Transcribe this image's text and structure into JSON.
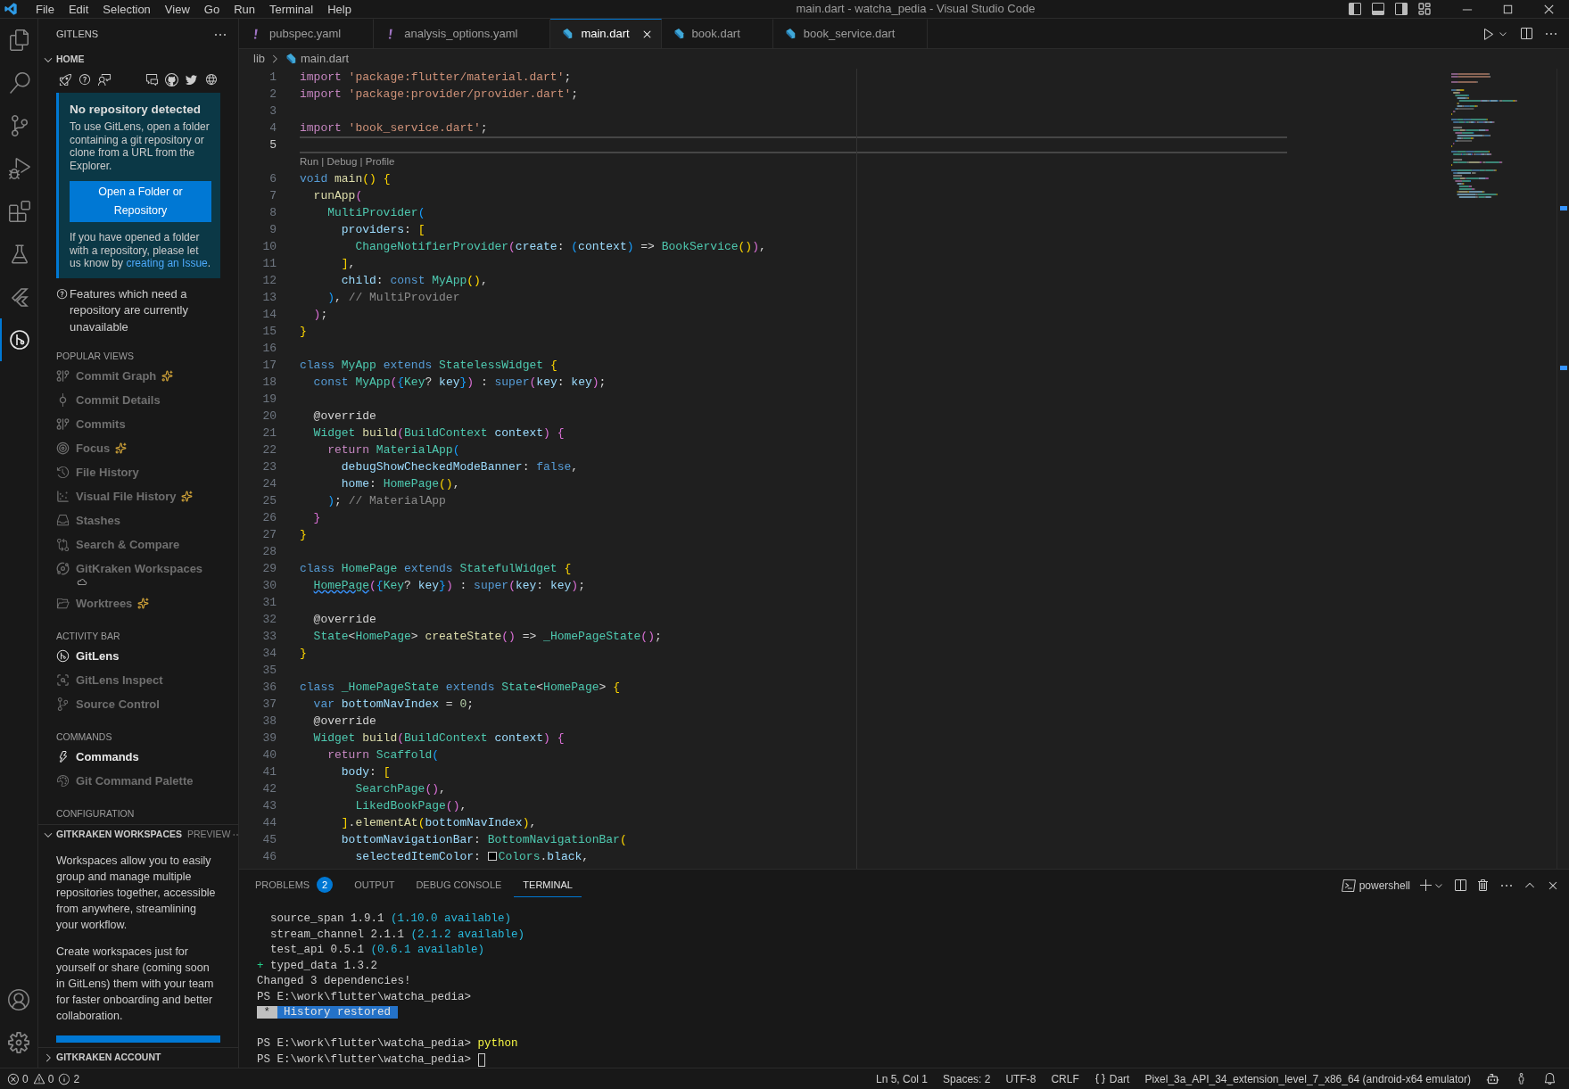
{
  "title_bar": {
    "menu": [
      "File",
      "Edit",
      "Selection",
      "View",
      "Go",
      "Run",
      "Terminal",
      "Help"
    ],
    "title": "main.dart - watcha_pedia - Visual Studio Code"
  },
  "activity_bar": {
    "items": [
      {
        "kind": "files",
        "selected": false
      },
      {
        "kind": "search",
        "selected": false
      },
      {
        "kind": "scm",
        "selected": false
      },
      {
        "kind": "debug",
        "selected": false
      },
      {
        "kind": "extensions",
        "selected": false
      },
      {
        "kind": "testing",
        "selected": false
      },
      {
        "kind": "flutter",
        "selected": false
      },
      {
        "kind": "gitlens",
        "selected": true
      }
    ],
    "bottom": [
      {
        "kind": "account"
      },
      {
        "kind": "settings"
      }
    ]
  },
  "sidebar": {
    "title": "GITLENS",
    "home": {
      "title": "HOME",
      "expanded": true,
      "card": {
        "title": "No repository detected",
        "text": "To use GitLens, open a folder containing a git repository or clone from a URL from the Explorer.",
        "button": "Open a Folder or Repository",
        "note": "If you have opened a folder with a repository, please let us know by",
        "link": "creating an Issue",
        "note_end": "."
      },
      "features_note": "Features which need a repository are currently unavailable",
      "groups": [
        {
          "title": "POPULAR VIEWS",
          "items": [
            {
              "label": "Commit Graph",
              "kind": "graph",
              "sparkle": true,
              "cloud": false,
              "disabled": true
            },
            {
              "label": "Commit Details",
              "kind": "commit",
              "sparkle": false,
              "cloud": false,
              "disabled": true
            },
            {
              "label": "Commits",
              "kind": "commits",
              "sparkle": false,
              "cloud": false,
              "disabled": true
            },
            {
              "label": "Focus",
              "kind": "focus",
              "sparkle": true,
              "cloud": false,
              "disabled": true
            },
            {
              "label": "File History",
              "kind": "history",
              "sparkle": false,
              "cloud": false,
              "disabled": true
            },
            {
              "label": "Visual File History",
              "kind": "scatter",
              "sparkle": true,
              "cloud": false,
              "disabled": true
            },
            {
              "label": "Stashes",
              "kind": "inbox",
              "sparkle": false,
              "cloud": false,
              "disabled": true
            },
            {
              "label": "Search & Compare",
              "kind": "compare",
              "sparkle": false,
              "cloud": false,
              "disabled": true
            },
            {
              "label": "GitKraken Workspaces",
              "kind": "orbit",
              "sparkle": false,
              "cloud": true,
              "disabled": true
            },
            {
              "label": "Worktrees",
              "kind": "folder",
              "sparkle": true,
              "cloud": false,
              "disabled": true
            }
          ]
        },
        {
          "title": "ACTIVITY BAR",
          "items": [
            {
              "label": "GitLens",
              "kind": "gitlens",
              "sparkle": false,
              "cloud": false,
              "disabled": false
            },
            {
              "label": "GitLens Inspect",
              "kind": "inspect",
              "sparkle": false,
              "cloud": false,
              "disabled": true
            },
            {
              "label": "Source Control",
              "kind": "scm",
              "sparkle": false,
              "cloud": false,
              "disabled": true
            }
          ]
        },
        {
          "title": "COMMANDS",
          "items": [
            {
              "label": "Commands",
              "kind": "zap",
              "sparkle": false,
              "cloud": false,
              "disabled": false
            },
            {
              "label": "Git Command Palette",
              "kind": "palette",
              "sparkle": false,
              "cloud": false,
              "disabled": true
            }
          ]
        },
        {
          "title": "CONFIGURATION"
        }
      ]
    },
    "workspaces": {
      "title": "GITKRAKEN WORKSPACES",
      "badge": "PREVIEW",
      "expanded": true,
      "paragraphs": [
        "Workspaces allow you to easily group and manage multiple repositories together, accessible from anywhere, streamlining your workflow.",
        "Create workspaces just for yourself or share (coming soon in GitLens) them with your team for faster onboarding and better collaboration."
      ]
    },
    "account": {
      "title": "GITKRAKEN ACCOUNT",
      "expanded": false
    }
  },
  "tabs": [
    {
      "label": "pubspec.yaml",
      "kind": "yaml",
      "selected": false
    },
    {
      "label": "analysis_options.yaml",
      "kind": "yaml",
      "selected": false
    },
    {
      "label": "main.dart",
      "kind": "dart",
      "selected": true
    },
    {
      "label": "book.dart",
      "kind": "dart",
      "selected": false
    },
    {
      "label": "book_service.dart",
      "kind": "dart",
      "selected": false
    }
  ],
  "breadcrumb": {
    "folder": "lib",
    "file": "main.dart"
  },
  "editor": {
    "lines": [
      {
        "kind": "code",
        "number": "1",
        "current": false,
        "tokens": [
          {
            "kind": "ctrl",
            "text": "import "
          },
          {
            "kind": "str",
            "text": "'package:flutter/material.dart'"
          },
          {
            "kind": "plain",
            "text": ";"
          }
        ]
      },
      {
        "kind": "code",
        "number": "2",
        "current": false,
        "tokens": [
          {
            "kind": "ctrl",
            "text": "import "
          },
          {
            "kind": "str",
            "text": "'package:provider/provider.dart'"
          },
          {
            "kind": "plain",
            "text": ";"
          }
        ]
      },
      {
        "kind": "code",
        "number": "3",
        "current": false
      },
      {
        "kind": "code",
        "number": "4",
        "current": false,
        "tokens": [
          {
            "kind": "ctrl",
            "text": "import "
          },
          {
            "kind": "str",
            "text": "'book_service.dart'"
          },
          {
            "kind": "plain",
            "text": ";"
          }
        ]
      },
      {
        "kind": "code",
        "number": "5",
        "current": true
      },
      {
        "kind": "codelens",
        "text": "Run | Debug | Profile"
      },
      {
        "kind": "code",
        "number": "6",
        "current": false,
        "tokens": [
          {
            "kind": "kw",
            "text": "void "
          },
          {
            "kind": "fn",
            "text": "main"
          },
          {
            "kind": "b1",
            "text": "() {"
          }
        ]
      },
      {
        "kind": "code",
        "number": "7",
        "current": false,
        "tokens": [
          {
            "kind": "fn",
            "text": "  runApp"
          },
          {
            "kind": "b2",
            "text": "("
          }
        ]
      },
      {
        "kind": "code",
        "number": "8",
        "current": false,
        "tokens": [
          {
            "kind": "type",
            "text": "    MultiProvider"
          },
          {
            "kind": "b3",
            "text": "("
          }
        ]
      },
      {
        "kind": "code",
        "number": "9",
        "current": false,
        "tokens": [
          {
            "kind": "var",
            "text": "      providers"
          },
          {
            "kind": "plain",
            "text": ": "
          },
          {
            "kind": "b1",
            "text": "["
          }
        ]
      },
      {
        "kind": "code",
        "number": "10",
        "current": false,
        "tokens": [
          {
            "kind": "type",
            "text": "        ChangeNotifierProvider"
          },
          {
            "kind": "b2",
            "text": "("
          },
          {
            "kind": "var",
            "text": "create"
          },
          {
            "kind": "plain",
            "text": ": "
          },
          {
            "kind": "b3",
            "text": "("
          },
          {
            "kind": "var",
            "text": "context"
          },
          {
            "kind": "b3",
            "text": ")"
          },
          {
            "kind": "plain",
            "text": " => "
          },
          {
            "kind": "type",
            "text": "BookService"
          },
          {
            "kind": "b1",
            "text": "()"
          },
          {
            "kind": "b2",
            "text": ")"
          },
          {
            "kind": "plain",
            "text": ","
          }
        ]
      },
      {
        "kind": "code",
        "number": "11",
        "current": false,
        "tokens": [
          {
            "kind": "b1",
            "text": "      ]"
          },
          {
            "kind": "plain",
            "text": ","
          }
        ]
      },
      {
        "kind": "code",
        "number": "12",
        "current": false,
        "tokens": [
          {
            "kind": "var",
            "text": "      child"
          },
          {
            "kind": "plain",
            "text": ": "
          },
          {
            "kind": "kw",
            "text": "const "
          },
          {
            "kind": "type",
            "text": "MyApp"
          },
          {
            "kind": "b1",
            "text": "()"
          },
          {
            "kind": "plain",
            "text": ","
          }
        ]
      },
      {
        "kind": "code",
        "number": "13",
        "current": false,
        "tokens": [
          {
            "kind": "b3",
            "text": "    )"
          },
          {
            "kind": "plain",
            "text": ", "
          },
          {
            "kind": "comment",
            "text": "// MultiProvider"
          }
        ]
      },
      {
        "kind": "code",
        "number": "14",
        "current": false,
        "tokens": [
          {
            "kind": "b2",
            "text": "  )"
          },
          {
            "kind": "plain",
            "text": ";"
          }
        ]
      },
      {
        "kind": "code",
        "number": "15",
        "current": false,
        "tokens": [
          {
            "kind": "b1",
            "text": "}"
          }
        ]
      },
      {
        "kind": "code",
        "number": "16",
        "current": false
      },
      {
        "kind": "code",
        "number": "17",
        "current": false,
        "tokens": [
          {
            "kind": "kw",
            "text": "class "
          },
          {
            "kind": "type",
            "text": "MyApp "
          },
          {
            "kind": "kw",
            "text": "extends "
          },
          {
            "kind": "type",
            "text": "StatelessWidget "
          },
          {
            "kind": "b1",
            "text": "{"
          }
        ]
      },
      {
        "kind": "code",
        "number": "18",
        "current": false,
        "tokens": [
          {
            "kind": "kw",
            "text": "  const "
          },
          {
            "kind": "type",
            "text": "MyApp"
          },
          {
            "kind": "b2",
            "text": "("
          },
          {
            "kind": "b3",
            "text": "{"
          },
          {
            "kind": "type",
            "text": "Key"
          },
          {
            "kind": "plain",
            "text": "? "
          },
          {
            "kind": "var",
            "text": "key"
          },
          {
            "kind": "b3",
            "text": "}"
          },
          {
            "kind": "b2",
            "text": ")"
          },
          {
            "kind": "plain",
            "text": " : "
          },
          {
            "kind": "kw",
            "text": "super"
          },
          {
            "kind": "b2",
            "text": "("
          },
          {
            "kind": "var",
            "text": "key"
          },
          {
            "kind": "plain",
            "text": ": "
          },
          {
            "kind": "var",
            "text": "key"
          },
          {
            "kind": "b2",
            "text": ")"
          },
          {
            "kind": "plain",
            "text": ";"
          }
        ]
      },
      {
        "kind": "code",
        "number": "19",
        "current": false
      },
      {
        "kind": "code",
        "number": "20",
        "current": false,
        "tokens": [
          {
            "kind": "plain",
            "text": "  @override"
          }
        ]
      },
      {
        "kind": "code",
        "number": "21",
        "current": false,
        "tokens": [
          {
            "kind": "type",
            "text": "  Widget "
          },
          {
            "kind": "fn",
            "text": "build"
          },
          {
            "kind": "b2",
            "text": "("
          },
          {
            "kind": "type",
            "text": "BuildContext "
          },
          {
            "kind": "var",
            "text": "context"
          },
          {
            "kind": "b2",
            "text": ") {"
          }
        ]
      },
      {
        "kind": "code",
        "number": "22",
        "current": false,
        "tokens": [
          {
            "kind": "ctrl",
            "text": "    return "
          },
          {
            "kind": "type",
            "text": "MaterialApp"
          },
          {
            "kind": "b3",
            "text": "("
          }
        ]
      },
      {
        "kind": "code",
        "number": "23",
        "current": false,
        "tokens": [
          {
            "kind": "var",
            "text": "      debugShowCheckedModeBanner"
          },
          {
            "kind": "plain",
            "text": ": "
          },
          {
            "kind": "kw",
            "text": "false"
          },
          {
            "kind": "plain",
            "text": ","
          }
        ]
      },
      {
        "kind": "code",
        "number": "24",
        "current": false,
        "tokens": [
          {
            "kind": "var",
            "text": "      home"
          },
          {
            "kind": "plain",
            "text": ": "
          },
          {
            "kind": "type",
            "text": "HomePage"
          },
          {
            "kind": "b1",
            "text": "()"
          },
          {
            "kind": "plain",
            "text": ","
          }
        ]
      },
      {
        "kind": "code",
        "number": "25",
        "current": false,
        "tokens": [
          {
            "kind": "b3",
            "text": "    )"
          },
          {
            "kind": "plain",
            "text": "; "
          },
          {
            "kind": "comment",
            "text": "// MaterialApp"
          }
        ]
      },
      {
        "kind": "code",
        "number": "26",
        "current": false,
        "tokens": [
          {
            "kind": "b2",
            "text": "  }"
          }
        ]
      },
      {
        "kind": "code",
        "number": "27",
        "current": false,
        "tokens": [
          {
            "kind": "b1",
            "text": "}"
          }
        ]
      },
      {
        "kind": "code",
        "number": "28",
        "current": false
      },
      {
        "kind": "code",
        "number": "29",
        "current": false,
        "tokens": [
          {
            "kind": "kw",
            "text": "class "
          },
          {
            "kind": "type",
            "text": "HomePage "
          },
          {
            "kind": "kw",
            "text": "extends "
          },
          {
            "kind": "type",
            "text": "StatefulWidget "
          },
          {
            "kind": "b1",
            "text": "{"
          }
        ]
      },
      {
        "kind": "code",
        "number": "30",
        "current": false,
        "tokens": [
          {
            "kind": "type-info",
            "text": "  HomePage"
          },
          {
            "kind": "b2",
            "text": "("
          },
          {
            "kind": "b3",
            "text": "{"
          },
          {
            "kind": "type",
            "text": "Key"
          },
          {
            "kind": "plain",
            "text": "? "
          },
          {
            "kind": "var",
            "text": "key"
          },
          {
            "kind": "b3",
            "text": "}"
          },
          {
            "kind": "b2",
            "text": ")"
          },
          {
            "kind": "plain",
            "text": " : "
          },
          {
            "kind": "kw",
            "text": "super"
          },
          {
            "kind": "b2",
            "text": "("
          },
          {
            "kind": "var",
            "text": "key"
          },
          {
            "kind": "plain",
            "text": ": "
          },
          {
            "kind": "var",
            "text": "key"
          },
          {
            "kind": "b2",
            "text": ")"
          },
          {
            "kind": "plain",
            "text": ";"
          }
        ]
      },
      {
        "kind": "code",
        "number": "31",
        "current": false
      },
      {
        "kind": "code",
        "number": "32",
        "current": false,
        "tokens": [
          {
            "kind": "plain",
            "text": "  @override"
          }
        ]
      },
      {
        "kind": "code",
        "number": "33",
        "current": false,
        "tokens": [
          {
            "kind": "type",
            "text": "  State"
          },
          {
            "kind": "plain",
            "text": "<"
          },
          {
            "kind": "type",
            "text": "HomePage"
          },
          {
            "kind": "plain",
            "text": "> "
          },
          {
            "kind": "fn",
            "text": "createState"
          },
          {
            "kind": "b2",
            "text": "()"
          },
          {
            "kind": "plain",
            "text": " => "
          },
          {
            "kind": "type",
            "text": "_HomePageState"
          },
          {
            "kind": "b2",
            "text": "()"
          },
          {
            "kind": "plain",
            "text": ";"
          }
        ]
      },
      {
        "kind": "code",
        "number": "34",
        "current": false,
        "tokens": [
          {
            "kind": "b1",
            "text": "}"
          }
        ]
      },
      {
        "kind": "code",
        "number": "35",
        "current": false
      },
      {
        "kind": "code",
        "number": "36",
        "current": false,
        "tokens": [
          {
            "kind": "kw",
            "text": "class "
          },
          {
            "kind": "type",
            "text": "_HomePageState "
          },
          {
            "kind": "kw",
            "text": "extends "
          },
          {
            "kind": "type",
            "text": "State"
          },
          {
            "kind": "plain",
            "text": "<"
          },
          {
            "kind": "type",
            "text": "HomePage"
          },
          {
            "kind": "plain",
            "text": "> "
          },
          {
            "kind": "b1",
            "text": "{"
          }
        ]
      },
      {
        "kind": "code",
        "number": "37",
        "current": false,
        "tokens": [
          {
            "kind": "kw",
            "text": "  var "
          },
          {
            "kind": "var",
            "text": "bottomNavIndex"
          },
          {
            "kind": "plain",
            "text": " = "
          },
          {
            "kind": "num",
            "text": "0"
          },
          {
            "kind": "plain",
            "text": ";"
          }
        ]
      },
      {
        "kind": "code",
        "number": "38",
        "current": false,
        "tokens": [
          {
            "kind": "plain",
            "text": "  @override"
          }
        ]
      },
      {
        "kind": "code",
        "number": "39",
        "current": false,
        "tokens": [
          {
            "kind": "type",
            "text": "  Widget "
          },
          {
            "kind": "fn",
            "text": "build"
          },
          {
            "kind": "b2",
            "text": "("
          },
          {
            "kind": "type",
            "text": "BuildContext "
          },
          {
            "kind": "var",
            "text": "context"
          },
          {
            "kind": "b2",
            "text": ") {"
          }
        ]
      },
      {
        "kind": "code",
        "number": "40",
        "current": false,
        "tokens": [
          {
            "kind": "ctrl",
            "text": "    return "
          },
          {
            "kind": "type",
            "text": "Scaffold"
          },
          {
            "kind": "b3",
            "text": "("
          }
        ]
      },
      {
        "kind": "code",
        "number": "41",
        "current": false,
        "tokens": [
          {
            "kind": "var",
            "text": "      body"
          },
          {
            "kind": "plain",
            "text": ": "
          },
          {
            "kind": "b1",
            "text": "["
          }
        ]
      },
      {
        "kind": "code",
        "number": "42",
        "current": false,
        "tokens": [
          {
            "kind": "type",
            "text": "        SearchPage"
          },
          {
            "kind": "b2",
            "text": "()"
          },
          {
            "kind": "plain",
            "text": ","
          }
        ]
      },
      {
        "kind": "code",
        "number": "43",
        "current": false,
        "tokens": [
          {
            "kind": "type",
            "text": "        LikedBookPage"
          },
          {
            "kind": "b2",
            "text": "()"
          },
          {
            "kind": "plain",
            "text": ","
          }
        ]
      },
      {
        "kind": "code",
        "number": "44",
        "current": false,
        "tokens": [
          {
            "kind": "b1",
            "text": "      ]"
          },
          {
            "kind": "plain",
            "text": "."
          },
          {
            "kind": "fn",
            "text": "elementAt"
          },
          {
            "kind": "b1",
            "text": "("
          },
          {
            "kind": "var",
            "text": "bottomNavIndex"
          },
          {
            "kind": "b1",
            "text": ")"
          },
          {
            "kind": "plain",
            "text": ","
          }
        ]
      },
      {
        "kind": "code",
        "number": "45",
        "current": false,
        "tokens": [
          {
            "kind": "var",
            "text": "      bottomNavigationBar"
          },
          {
            "kind": "plain",
            "text": ": "
          },
          {
            "kind": "type",
            "text": "BottomNavigationBar"
          },
          {
            "kind": "b1",
            "text": "("
          }
        ]
      },
      {
        "kind": "code",
        "number": "46",
        "current": false,
        "tokens": [
          {
            "kind": "var",
            "text": "        selectedItemColor"
          },
          {
            "kind": "plain",
            "text": ": "
          },
          {
            "kind": "swatch",
            "color": "#000000"
          },
          {
            "kind": "type",
            "text": "Colors"
          },
          {
            "kind": "plain",
            "text": "."
          },
          {
            "kind": "var",
            "text": "black"
          },
          {
            "kind": "plain",
            "text": ","
          }
        ]
      }
    ]
  },
  "panel": {
    "tabs": [
      {
        "label": "PROBLEMS",
        "badge": "2",
        "selected": false
      },
      {
        "label": "OUTPUT",
        "selected": false
      },
      {
        "label": "DEBUG CONSOLE",
        "selected": false
      },
      {
        "label": "TERMINAL",
        "selected": true
      }
    ],
    "terminal_name": "powershell",
    "lines": [
      {
        "kind": "text",
        "segments": [
          {
            "kind": "plain",
            "text": "  source_span 1.9.1 "
          },
          {
            "kind": "info",
            "text": "(1.10.0 available)"
          }
        ]
      },
      {
        "kind": "text",
        "segments": [
          {
            "kind": "plain",
            "text": "  stream_channel 2.1.1 "
          },
          {
            "kind": "info",
            "text": "(2.1.2 available)"
          }
        ]
      },
      {
        "kind": "text",
        "segments": [
          {
            "kind": "plain",
            "text": "  test_api 0.5.1 "
          },
          {
            "kind": "info",
            "text": "(0.6.1 available)"
          }
        ]
      },
      {
        "kind": "text",
        "segments": [
          {
            "kind": "added",
            "text": "+ "
          },
          {
            "kind": "plain",
            "text": "typed_data 1.3.2"
          }
        ]
      },
      {
        "kind": "text",
        "segments": [
          {
            "kind": "plain",
            "text": "Changed 3 dependencies!"
          }
        ]
      },
      {
        "kind": "text",
        "segments": [
          {
            "kind": "plain",
            "text": "PS E:\\work\\flutter\\watcha_pedia>"
          }
        ]
      },
      {
        "kind": "text",
        "segments": [
          {
            "kind": "mark",
            "text": " * "
          },
          {
            "kind": "highlight",
            "text": " History restored "
          }
        ]
      },
      {
        "kind": "blank"
      },
      {
        "kind": "text",
        "segments": [
          {
            "kind": "plain",
            "text": "PS E:\\work\\flutter\\watcha_pedia> "
          },
          {
            "kind": "command",
            "text": "python"
          }
        ]
      },
      {
        "kind": "cursor",
        "segments": [
          {
            "kind": "plain",
            "text": "PS E:\\work\\flutter\\watcha_pedia> "
          }
        ]
      }
    ]
  },
  "status_bar": {
    "errors": "0",
    "warnings": "0",
    "infos": "2",
    "items": [
      {
        "kind": "text",
        "text": "Ln 5, Col 1"
      },
      {
        "kind": "text",
        "text": "Spaces: 2"
      },
      {
        "kind": "text",
        "text": "UTF-8"
      },
      {
        "kind": "text",
        "text": "CRLF"
      },
      {
        "kind": "language",
        "text": "Dart"
      },
      {
        "kind": "text",
        "text": "Pixel_3a_API_34_extension_level_7_x86_64 (android-x64 emulator)"
      }
    ]
  }
}
